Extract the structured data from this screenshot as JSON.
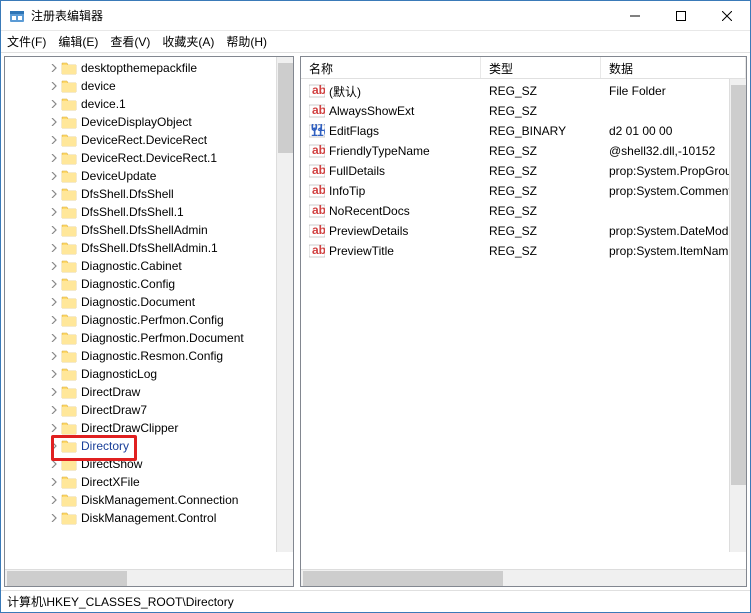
{
  "window": {
    "title": "注册表编辑器"
  },
  "menu": {
    "file": "文件(F)",
    "edit": "编辑(E)",
    "view": "查看(V)",
    "fav": "收藏夹(A)",
    "help": "帮助(H)"
  },
  "tree": {
    "items": [
      {
        "label": "desktopthemepackfile",
        "sel": false
      },
      {
        "label": "device",
        "sel": false
      },
      {
        "label": "device.1",
        "sel": false
      },
      {
        "label": "DeviceDisplayObject",
        "sel": false
      },
      {
        "label": "DeviceRect.DeviceRect",
        "sel": false
      },
      {
        "label": "DeviceRect.DeviceRect.1",
        "sel": false
      },
      {
        "label": "DeviceUpdate",
        "sel": false
      },
      {
        "label": "DfsShell.DfsShell",
        "sel": false
      },
      {
        "label": "DfsShell.DfsShell.1",
        "sel": false
      },
      {
        "label": "DfsShell.DfsShellAdmin",
        "sel": false
      },
      {
        "label": "DfsShell.DfsShellAdmin.1",
        "sel": false
      },
      {
        "label": "Diagnostic.Cabinet",
        "sel": false
      },
      {
        "label": "Diagnostic.Config",
        "sel": false
      },
      {
        "label": "Diagnostic.Document",
        "sel": false
      },
      {
        "label": "Diagnostic.Perfmon.Config",
        "sel": false
      },
      {
        "label": "Diagnostic.Perfmon.Document",
        "sel": false
      },
      {
        "label": "Diagnostic.Resmon.Config",
        "sel": false
      },
      {
        "label": "DiagnosticLog",
        "sel": false
      },
      {
        "label": "DirectDraw",
        "sel": false
      },
      {
        "label": "DirectDraw7",
        "sel": false
      },
      {
        "label": "DirectDrawClipper",
        "sel": false
      },
      {
        "label": "Directory",
        "sel": true
      },
      {
        "label": "DirectShow",
        "sel": false
      },
      {
        "label": "DirectXFile",
        "sel": false
      },
      {
        "label": "DiskManagement.Connection",
        "sel": false
      },
      {
        "label": "DiskManagement.Control",
        "sel": false
      }
    ]
  },
  "list": {
    "head": {
      "name": "名称",
      "type": "类型",
      "data": "数据"
    },
    "rows": [
      {
        "icon": "str",
        "name": "(默认)",
        "type": "REG_SZ",
        "data": "File Folder"
      },
      {
        "icon": "str",
        "name": "AlwaysShowExt",
        "type": "REG_SZ",
        "data": ""
      },
      {
        "icon": "bin",
        "name": "EditFlags",
        "type": "REG_BINARY",
        "data": "d2 01 00 00"
      },
      {
        "icon": "str",
        "name": "FriendlyTypeName",
        "type": "REG_SZ",
        "data": "@shell32.dll,-10152"
      },
      {
        "icon": "str",
        "name": "FullDetails",
        "type": "REG_SZ",
        "data": "prop:System.PropGrou"
      },
      {
        "icon": "str",
        "name": "InfoTip",
        "type": "REG_SZ",
        "data": "prop:System.Comment"
      },
      {
        "icon": "str",
        "name": "NoRecentDocs",
        "type": "REG_SZ",
        "data": ""
      },
      {
        "icon": "str",
        "name": "PreviewDetails",
        "type": "REG_SZ",
        "data": "prop:System.DateMod"
      },
      {
        "icon": "str",
        "name": "PreviewTitle",
        "type": "REG_SZ",
        "data": "prop:System.ItemNam"
      }
    ]
  },
  "status": {
    "path": "计算机\\HKEY_CLASSES_ROOT\\Directory"
  }
}
